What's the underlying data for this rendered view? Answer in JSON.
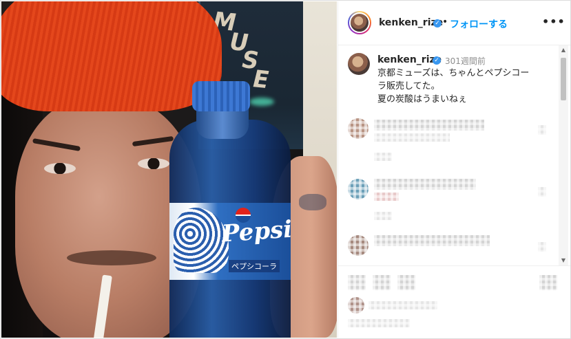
{
  "post": {
    "username": "kenken_rize",
    "verified": true,
    "separator": "•",
    "follow_label": "フォローする",
    "more_icon": "more-horizontal-icon"
  },
  "caption": {
    "username": "kenken_rize",
    "timestamp": "301週間前",
    "lines": [
      "京都ミューズは、ちゃんとペプシコー",
      "ラ販売してた。",
      "夏の炭酸はうまいねぇ"
    ]
  },
  "photo": {
    "sign_letters": [
      "M",
      "U",
      "S",
      "E"
    ],
    "bottle_brand": "Pepsi",
    "bottle_label_small": "ペプシコーラ"
  },
  "colors": {
    "follow_blue": "#0095f6",
    "verified_blue": "#3897f0",
    "border": "#dbdbdb",
    "muted_text": "#8e8e8e"
  }
}
